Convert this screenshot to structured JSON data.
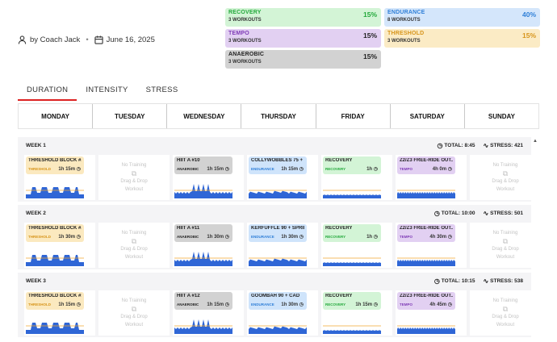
{
  "meta": {
    "author": "by Coach Jack",
    "date": "June 16, 2025"
  },
  "zones": [
    {
      "name": "RECOVERY",
      "workouts": "3 WORKOUTS",
      "pct": "15%",
      "color": "#22a83a",
      "bg": "#d3f4d6",
      "col": 0,
      "row": 0
    },
    {
      "name": "ENDURANCE",
      "workouts": "8 WORKOUTS",
      "pct": "40%",
      "color": "#2f7fd7",
      "bg": "#d4e6fb",
      "col": 1,
      "row": 0
    },
    {
      "name": "TEMPO",
      "workouts": "3 WORKOUTS",
      "pct": "15%",
      "color": "#7f3bb6",
      "bg": "#e2d0f2",
      "col": 0,
      "row": 1
    },
    {
      "name": "THRESHOLD",
      "workouts": "3 WORKOUTS",
      "pct": "15%",
      "color": "#d7951c",
      "bg": "#fbebc5",
      "col": 1,
      "row": 1
    },
    {
      "name": "ANAEROBIC",
      "workouts": "3 WORKOUTS",
      "pct": "15%",
      "color": "#222222",
      "bg": "#d2d2d2",
      "col": 0,
      "row": 2
    }
  ],
  "tabs": [
    {
      "label": "DURATION",
      "active": true
    },
    {
      "label": "INTENSITY",
      "active": false
    },
    {
      "label": "STRESS",
      "active": false
    }
  ],
  "days": [
    "MONDAY",
    "TUESDAY",
    "WEDNESDAY",
    "THURSDAY",
    "FRIDAY",
    "SATURDAY",
    "SUNDAY"
  ],
  "empty": {
    "line1": "No Training",
    "line2": "Drag & Drop",
    "line3": "Workout"
  },
  "weeks": [
    {
      "label": "WEEK 1",
      "total": "TOTAL: 8:45",
      "stress": "STRESS: 421",
      "workouts": [
        {
          "title": "THRESHOLD BLOCK #...",
          "zone": "THRESHOLD",
          "duration": "1h 15m",
          "shape": "threshold"
        },
        null,
        {
          "title": "HIIT A #10",
          "zone": "ANAEROBIC",
          "duration": "1h 15m",
          "shape": "hiit"
        },
        {
          "title": "COLLYWOBBLES 75 + ...",
          "zone": "ENDURANCE",
          "duration": "1h 15m",
          "shape": "endurance"
        },
        {
          "title": "RECOVERY",
          "zone": "RECOVERY",
          "duration": "1h",
          "shape": "recovery"
        },
        {
          "title": "Z2/Z3 FREE-RIDE OUT...",
          "zone": "TEMPO",
          "duration": "4h 0m",
          "shape": "tempo"
        },
        null
      ]
    },
    {
      "label": "WEEK 2",
      "total": "TOTAL: 10:00",
      "stress": "STRESS: 501",
      "workouts": [
        {
          "title": "THRESHOLD BLOCK #...",
          "zone": "THRESHOLD",
          "duration": "1h 30m",
          "shape": "threshold"
        },
        null,
        {
          "title": "HIIT A #11",
          "zone": "ANAEROBIC",
          "duration": "1h 30m",
          "shape": "hiit"
        },
        {
          "title": "KERFUFFLE 90 + SPRIN...",
          "zone": "ENDURANCE",
          "duration": "1h 30m",
          "shape": "endurance"
        },
        {
          "title": "RECOVERY",
          "zone": "RECOVERY",
          "duration": "1h",
          "shape": "recovery"
        },
        {
          "title": "Z2/Z3 FREE-RIDE OUT...",
          "zone": "TEMPO",
          "duration": "4h 30m",
          "shape": "tempo"
        },
        null
      ]
    },
    {
      "label": "WEEK 3",
      "total": "TOTAL: 10:15",
      "stress": "STRESS: 538",
      "workouts": [
        {
          "title": "THRESHOLD BLOCK #1...",
          "zone": "THRESHOLD",
          "duration": "1h 15m",
          "shape": "threshold"
        },
        null,
        {
          "title": "HIIT A #12",
          "zone": "ANAEROBIC",
          "duration": "1h 15m",
          "shape": "hiit"
        },
        {
          "title": "GOOMBAH 90 + CAD",
          "zone": "ENDURANCE",
          "duration": "1h 30m",
          "shape": "endurance"
        },
        {
          "title": "RECOVERY",
          "zone": "RECOVERY",
          "duration": "1h 15m",
          "shape": "recovery"
        },
        {
          "title": "Z2/Z3 FREE-RIDE OUT...",
          "zone": "TEMPO",
          "duration": "4h 45m",
          "shape": "tempo"
        },
        null
      ]
    }
  ],
  "colors": {
    "chart": "#2f66d6",
    "threshold_line": "#f0a830",
    "active_tab": "#dd2222"
  }
}
